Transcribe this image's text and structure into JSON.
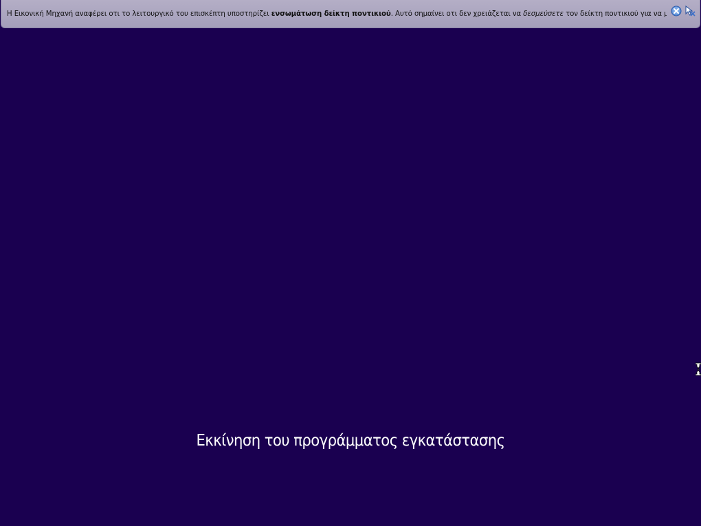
{
  "notification": {
    "text_part1": "Η Εικονική Μηχανή αναφέρει οτι το λειτουργικό του επισκέπτη υποστηρίζει ",
    "text_bold": "ενσωμάτωση δείκτη ποντικιού",
    "text_part2": ". Αυτό σημαίνει οτι δεν χρειάζεται να ",
    "text_italic": "δεσμεύσετε",
    "text_part3": " τον δείκτη ποντικιού για να μπορέσετε",
    "close_icon": "close-icon",
    "mouse_integration_icon": "mouse-pointer-icon"
  },
  "main": {
    "status_text": "Εκκίνηση του προγράμματος εγκατάστασης"
  },
  "colors": {
    "background": "#1a0050",
    "notification_bg": "#aba6c0",
    "status_text": "#ffffff"
  }
}
